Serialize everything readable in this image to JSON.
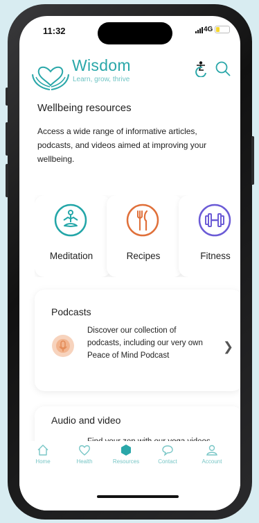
{
  "status_bar": {
    "time": "11:32",
    "network": "4G",
    "battery_level": 0.3
  },
  "header": {
    "brand": "Wisdom",
    "tagline": "Learn, grow, thrive"
  },
  "resources": {
    "title": "Wellbeing resources",
    "description": "Access a wide range of informative articles, podcasts, and videos aimed at improving your wellbeing.",
    "categories": [
      {
        "label": "Meditation",
        "icon": "meditation-icon",
        "color": "#23a6a8"
      },
      {
        "label": "Recipes",
        "icon": "cutlery-icon",
        "color": "#e0703a"
      },
      {
        "label": "Fitness",
        "icon": "dumbbell-icon",
        "color": "#6b5bd6"
      }
    ],
    "podcasts": {
      "title": "Podcasts",
      "text": "Discover our collection of podcasts, including our very own Peace of Mind Podcast"
    },
    "audio_video": {
      "title": "Audio and video",
      "text": "Find your zen with our yoga videos or our guided"
    }
  },
  "nav": {
    "items": [
      {
        "label": "Home"
      },
      {
        "label": "Health"
      },
      {
        "label": "Resources"
      },
      {
        "label": "Contact"
      },
      {
        "label": "Account"
      }
    ],
    "active": "Resources"
  },
  "colors": {
    "accent": "#2aa7a9",
    "accent_light": "#78c6c6",
    "background": "#d8ecf1"
  }
}
